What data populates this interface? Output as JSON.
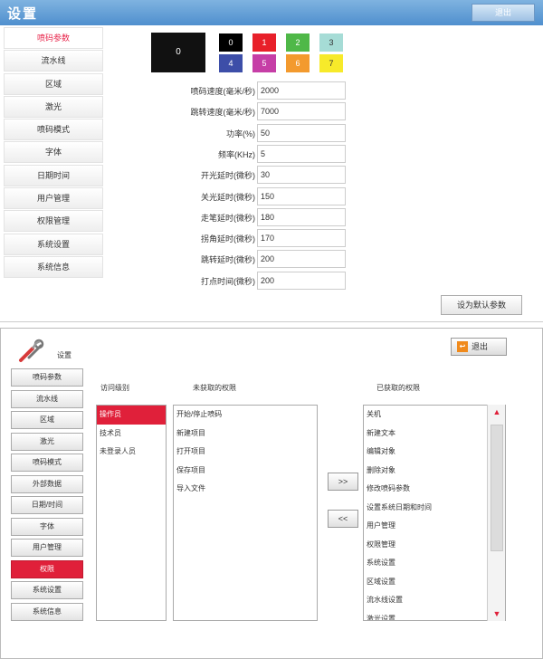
{
  "top": {
    "title": "设置",
    "exit_label": "退出",
    "sidebar": [
      {
        "label": "喷码参数",
        "active": true
      },
      {
        "label": "流水线"
      },
      {
        "label": "区域"
      },
      {
        "label": "激光"
      },
      {
        "label": "喷码模式"
      },
      {
        "label": "字体"
      },
      {
        "label": "日期时间"
      },
      {
        "label": "用户管理"
      },
      {
        "label": "权限管理"
      },
      {
        "label": "系统设置"
      },
      {
        "label": "系统信息"
      }
    ],
    "preview_value": "0",
    "swatches": [
      {
        "label": "0",
        "color": "#000000"
      },
      {
        "label": "1",
        "color": "#e8202a"
      },
      {
        "label": "2",
        "color": "#4fb848"
      },
      {
        "label": "3",
        "color": "#a6dcd6"
      },
      {
        "label": "4",
        "color": "#3d4ea8"
      },
      {
        "label": "5",
        "color": "#c63ea6"
      },
      {
        "label": "6",
        "color": "#f39a2e"
      },
      {
        "label": "7",
        "color": "#f7ea2a"
      }
    ],
    "params": [
      {
        "label": "喷码速度(毫米/秒)",
        "value": "2000"
      },
      {
        "label": "跳转速度(毫米/秒)",
        "value": "7000"
      },
      {
        "label": "功率(%)",
        "value": "50"
      },
      {
        "label": "频率(KHz)",
        "value": "5"
      },
      {
        "label": "开光延时(微秒)",
        "value": "30"
      },
      {
        "label": "关光延时(微秒)",
        "value": "150"
      },
      {
        "label": "走笔延时(微秒)",
        "value": "180"
      },
      {
        "label": "拐角延时(微秒)",
        "value": "170"
      },
      {
        "label": "跳转延时(微秒)",
        "value": "200"
      },
      {
        "label": "打点时间(微秒)",
        "value": "200"
      }
    ],
    "default_button": "设为默认参数"
  },
  "bottom": {
    "title": "设置",
    "exit_label": "退出",
    "sidebar": [
      {
        "label": "喷码参数"
      },
      {
        "label": "流水线"
      },
      {
        "label": "区域"
      },
      {
        "label": "激光"
      },
      {
        "label": "喷码模式"
      },
      {
        "label": "外部数据"
      },
      {
        "label": "日期/时间"
      },
      {
        "label": "字体"
      },
      {
        "label": "用户管理"
      },
      {
        "label": "权限",
        "active": true
      },
      {
        "label": "系统设置"
      },
      {
        "label": "系统信息"
      }
    ],
    "headers": {
      "access_level": "访问级别",
      "not_granted": "未获取的权限",
      "granted": "已获取的权限"
    },
    "levels": [
      {
        "label": "操作员",
        "selected": true
      },
      {
        "label": "技术员"
      },
      {
        "label": "未登录人员"
      }
    ],
    "not_granted": [
      "开始/停止喷码",
      "新建项目",
      "打开项目",
      "保存项目",
      "导入文件"
    ],
    "granted": [
      "关机",
      "新建文本",
      "编辑对象",
      "删除对象",
      "修改喷码参数",
      "设置系统日期和时间",
      "用户管理",
      "权限管理",
      "系统设置",
      "区域设置",
      "流水线设置",
      "激光设置"
    ],
    "add_button": ">>",
    "remove_button": "<<"
  }
}
